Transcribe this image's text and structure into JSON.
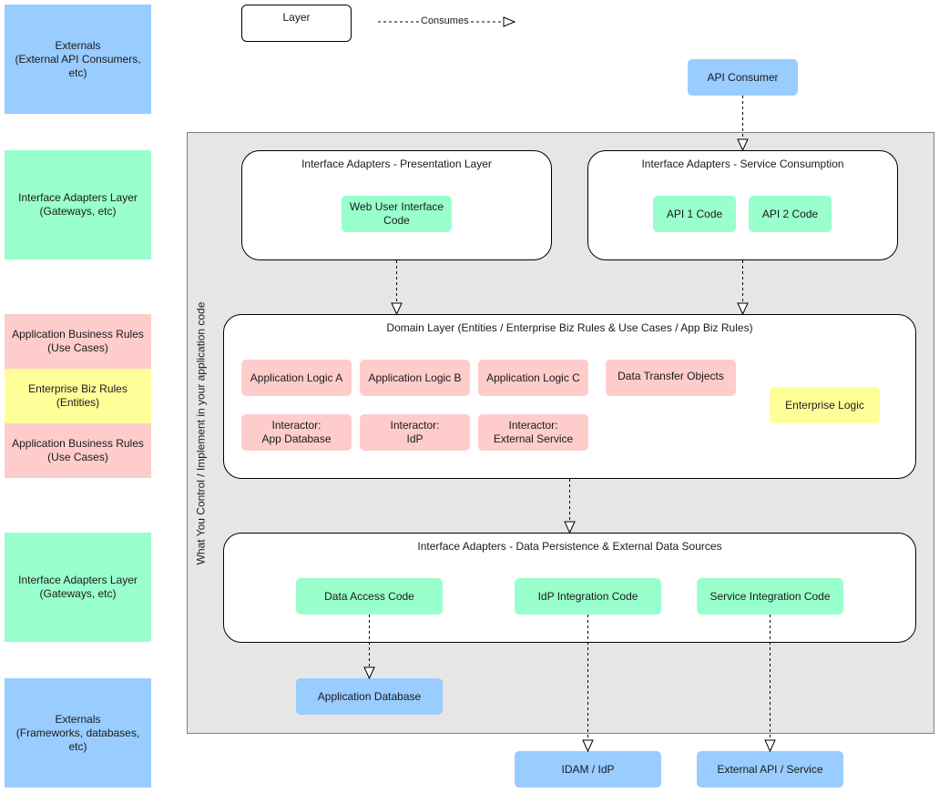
{
  "legend": {
    "layer_label": "Layer",
    "consumes_label": "Consumes"
  },
  "sidebar": {
    "blocks": [
      {
        "label": "Externals\n(External API Consumers,\netc)",
        "color": "#99ccff"
      },
      {
        "label": "Interface Adapters Layer\n(Gateways, etc)",
        "color": "#99ffcc"
      },
      {
        "label": "Application Business Rules\n(Use Cases)",
        "color": "#ffcccc"
      },
      {
        "label": "Enterprise Biz Rules\n(Entities)",
        "color": "#ffff99"
      },
      {
        "label": "Application Business Rules\n(Use Cases)",
        "color": "#ffcccc"
      },
      {
        "label": "Interface Adapters Layer\n(Gateways, etc)",
        "color": "#99ffcc"
      },
      {
        "label": "Externals\n(Frameworks, databases,\netc)",
        "color": "#99ccff"
      }
    ]
  },
  "container": {
    "vertical_label": "What You Control / Implement in your application code"
  },
  "externals_top": {
    "api_consumer": "API Consumer"
  },
  "presentation_layer": {
    "title": "Interface Adapters - Presentation Layer",
    "items": [
      "Web User Interface\nCode"
    ]
  },
  "service_consumption_layer": {
    "title": "Interface Adapters - Service Consumption",
    "items": [
      "API 1 Code",
      "API 2 Code"
    ]
  },
  "domain_layer": {
    "title": "Domain Layer (Entities / Enterprise Biz Rules & Use Cases / App Biz Rules)",
    "app_logic": [
      "Application Logic A",
      "Application Logic B",
      "Application Logic C"
    ],
    "interactors": [
      "Interactor:\nApp Database",
      "Interactor:\nIdP",
      "Interactor:\nExternal Service"
    ],
    "dto": "Data Transfer Objects",
    "enterprise_logic": "Enterprise Logic"
  },
  "persistence_layer": {
    "title": "Interface Adapters - Data Persistence & External Data Sources",
    "items": [
      "Data Access Code",
      "IdP Integration Code",
      "Service Integration Code"
    ]
  },
  "externals_bottom": {
    "app_database": "Application Database",
    "idam": "IDAM / IdP",
    "external_api": "External API / Service"
  },
  "colors": {
    "externals": "#99ccff",
    "adapters": "#99ffcc",
    "use_cases": "#ffcccc",
    "entities": "#ffff99",
    "container": "#e6e6e6"
  }
}
